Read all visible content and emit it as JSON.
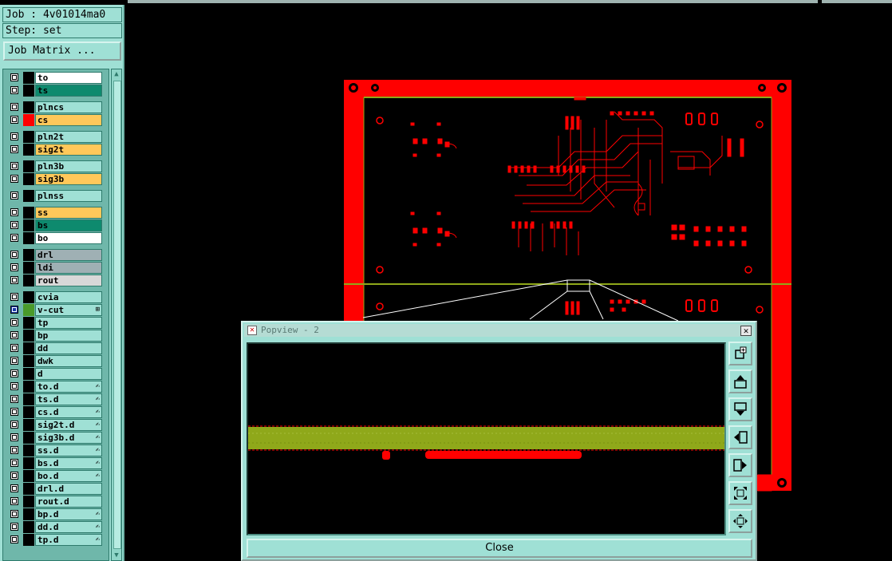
{
  "job_label": "Job : 4v01014ma0",
  "step_label": "Step: set",
  "job_matrix_button": "Job Matrix ...",
  "layers": [
    {
      "name": "to",
      "bg": "#ffffff",
      "swatch": "#000000"
    },
    {
      "name": "ts",
      "bg": "#0e8a6e",
      "swatch": "#000000"
    },
    {
      "name": "plncs",
      "bg": "#9fe0d5",
      "swatch": "#000000"
    },
    {
      "name": "cs",
      "bg": "#ffc85a",
      "swatch": "#ff0000"
    },
    {
      "name": "pln2t",
      "bg": "#9fe0d5",
      "swatch": "#000000"
    },
    {
      "name": "sig2t",
      "bg": "#ffc85a",
      "swatch": "#000000"
    },
    {
      "name": "pln3b",
      "bg": "#9fe0d5",
      "swatch": "#000000"
    },
    {
      "name": "sig3b",
      "bg": "#ffc85a",
      "swatch": "#000000"
    },
    {
      "name": "plnss",
      "bg": "#9fe0d5",
      "swatch": "#000000"
    },
    {
      "name": "ss",
      "bg": "#ffc85a",
      "swatch": "#000000"
    },
    {
      "name": "bs",
      "bg": "#0e8a6e",
      "swatch": "#000000"
    },
    {
      "name": "bo",
      "bg": "#ffffff",
      "swatch": "#000000"
    },
    {
      "name": "drl",
      "bg": "#9fb0b4",
      "swatch": "#000000"
    },
    {
      "name": "ldi",
      "bg": "#9fb0b4",
      "swatch": "#000000"
    },
    {
      "name": "rout",
      "bg": "#d8d8d8",
      "swatch": "#000000"
    },
    {
      "name": "cvia",
      "bg": "#9fe0d5",
      "swatch": "#000000"
    },
    {
      "name": "v-cut",
      "bg": "#9fe0d5",
      "swatch": "#4a9a2a",
      "selected": true,
      "mark": "⊞"
    },
    {
      "name": "tp",
      "bg": "#9fe0d5",
      "swatch": "#000000"
    },
    {
      "name": "bp",
      "bg": "#9fe0d5",
      "swatch": "#000000"
    },
    {
      "name": "dd",
      "bg": "#9fe0d5",
      "swatch": "#000000"
    },
    {
      "name": "dwk",
      "bg": "#9fe0d5",
      "swatch": "#000000"
    },
    {
      "name": "d",
      "bg": "#9fe0d5",
      "swatch": "#000000"
    },
    {
      "name": "to.d",
      "bg": "#9fe0d5",
      "swatch": "#000000",
      "mark": "✍"
    },
    {
      "name": "ts.d",
      "bg": "#9fe0d5",
      "swatch": "#000000",
      "mark": "✍"
    },
    {
      "name": "cs.d",
      "bg": "#9fe0d5",
      "swatch": "#000000",
      "mark": "✍"
    },
    {
      "name": "sig2t.d",
      "bg": "#9fe0d5",
      "swatch": "#000000",
      "mark": "✍"
    },
    {
      "name": "sig3b.d",
      "bg": "#9fe0d5",
      "swatch": "#000000",
      "mark": "✍"
    },
    {
      "name": "ss.d",
      "bg": "#9fe0d5",
      "swatch": "#000000",
      "mark": "✍"
    },
    {
      "name": "bs.d",
      "bg": "#9fe0d5",
      "swatch": "#000000",
      "mark": "✍"
    },
    {
      "name": "bo.d",
      "bg": "#9fe0d5",
      "swatch": "#000000",
      "mark": "✍"
    },
    {
      "name": "drl.d",
      "bg": "#9fe0d5",
      "swatch": "#000000"
    },
    {
      "name": "rout.d",
      "bg": "#9fe0d5",
      "swatch": "#000000"
    },
    {
      "name": "bp.d",
      "bg": "#9fe0d5",
      "swatch": "#000000",
      "mark": "✍"
    },
    {
      "name": "dd.d",
      "bg": "#9fe0d5",
      "swatch": "#000000",
      "mark": "✍"
    },
    {
      "name": "tp.d",
      "bg": "#9fe0d5",
      "swatch": "#000000",
      "mark": "✍"
    }
  ],
  "popview": {
    "title": "Popview - 2",
    "close_x": "✕",
    "close_button": "Close",
    "tools": [
      "zoom-area-icon",
      "pan-up-icon",
      "pan-down-icon",
      "pan-left-icon",
      "pan-right-icon",
      "zoom-fit-icon",
      "pan-center-icon"
    ]
  },
  "colors": {
    "panel": "#9fe0d5",
    "board_red": "#ff0000",
    "vcut_green": "#8fa81a",
    "canvas": "#000000"
  }
}
